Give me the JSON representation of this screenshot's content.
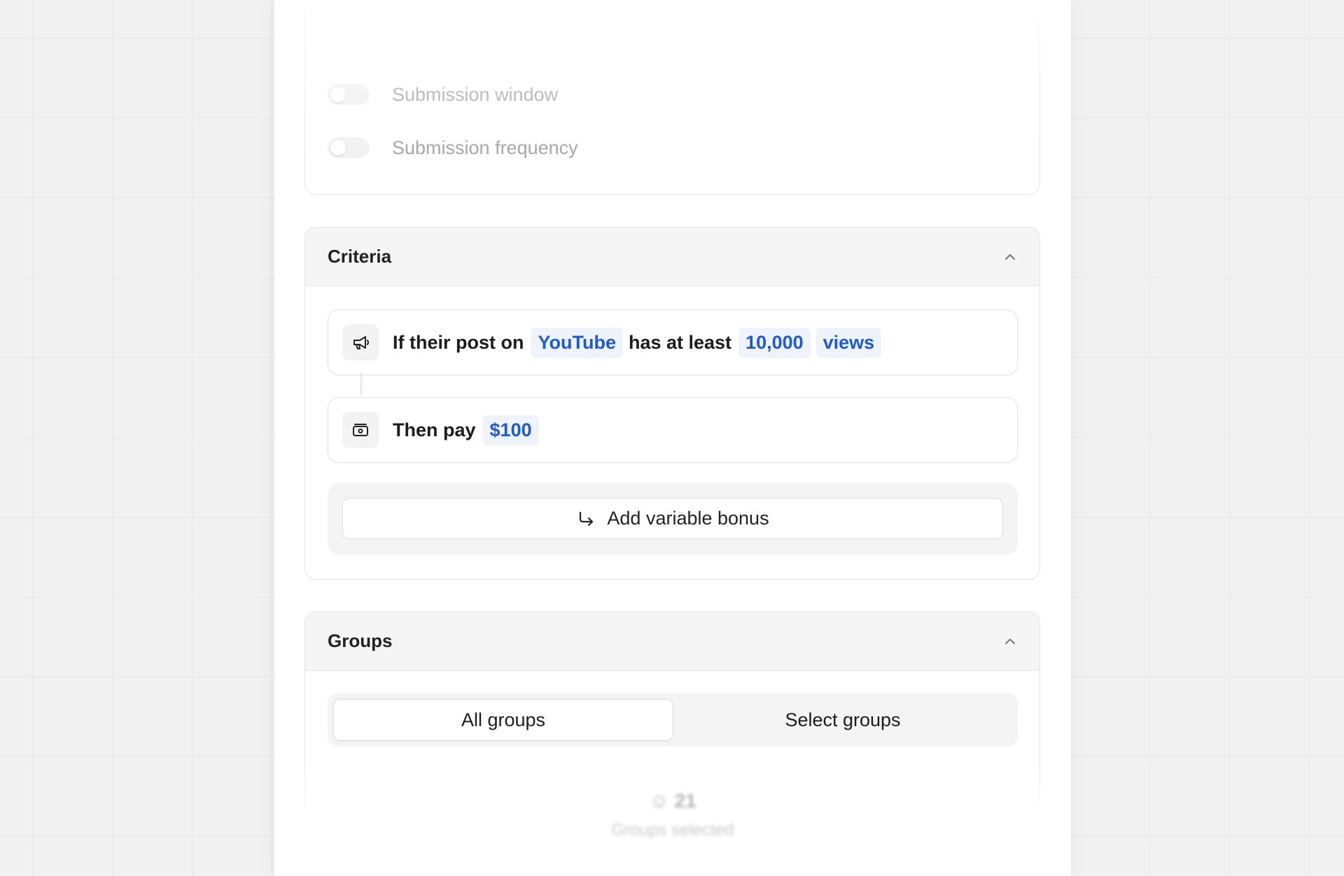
{
  "submission": {
    "window_label": "Submission window",
    "frequency_label": "Submission frequency"
  },
  "criteria": {
    "title": "Criteria",
    "rule": {
      "prefix": "If their post on",
      "platform": "YouTube",
      "middle": "has at least",
      "threshold": "10,000",
      "metric": "views"
    },
    "payout": {
      "prefix": "Then pay",
      "amount": "$100"
    },
    "add_bonus_label": "Add variable bonus"
  },
  "groups": {
    "title": "Groups",
    "options": [
      "All groups",
      "Select groups"
    ],
    "selected": "All groups",
    "count": "21",
    "count_caption": "Groups selected"
  },
  "colors": {
    "accent": "#1f5ad6",
    "chip_bg": "#eef3fd"
  }
}
